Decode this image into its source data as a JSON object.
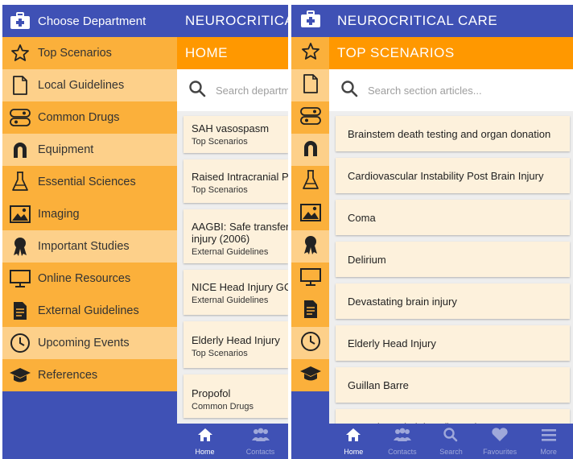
{
  "left": {
    "drawer": {
      "header_label": "Choose Department",
      "items": [
        {
          "label": "Top Scenarios",
          "icon": "star-icon"
        },
        {
          "label": "Local Guidelines",
          "icon": "document-icon"
        },
        {
          "label": "Common Drugs",
          "icon": "pill-icon"
        },
        {
          "label": "Equipment",
          "icon": "magnet-icon"
        },
        {
          "label": "Essential Sciences",
          "icon": "flask-icon"
        },
        {
          "label": "Imaging",
          "icon": "image-icon"
        },
        {
          "label": "Important Studies",
          "icon": "ribbon-icon"
        },
        {
          "label": "Online Resources",
          "icon": "monitor-icon"
        },
        {
          "label": "External Guidelines",
          "icon": "text-document-icon"
        },
        {
          "label": "Upcoming Events",
          "icon": "clock-icon"
        },
        {
          "label": "References",
          "icon": "graduation-cap-icon"
        }
      ]
    },
    "app_title": "NEUROCRITICAL CARE",
    "section_title": "HOME",
    "search_placeholder": "Search departments...",
    "cards": [
      {
        "title": "SAH vasospasm",
        "subtitle": "Top Scenarios"
      },
      {
        "title": "Raised Intracranial Pressure",
        "subtitle": "Top Scenarios"
      },
      {
        "title": "AAGBI: Safe transfer",
        "title2": "injury (2006)",
        "subtitle": "External Guidelines"
      },
      {
        "title": "NICE Head Injury GC",
        "subtitle": "External Guidelines"
      },
      {
        "title": "Elderly Head Injury",
        "subtitle": "Top Scenarios"
      },
      {
        "title": "Propofol",
        "subtitle": "Common Drugs"
      }
    ],
    "bottom_nav": [
      {
        "label": "Home",
        "icon": "home-icon"
      },
      {
        "label": "Contacts",
        "icon": "contacts-icon"
      }
    ]
  },
  "right": {
    "app_title": "NEUROCRITICAL CARE",
    "section_title": "TOP SCENARIOS",
    "search_placeholder": "Search section articles...",
    "articles": [
      "Brainstem death testing and organ donation",
      "Cardiovascular Instability Post Brain Injury",
      "Coma",
      "Delirium",
      "Devastating brain injury",
      "Elderly Head Injury",
      "Guillan Barre",
      "Hypoxic Brain injury (hypoxia"
    ],
    "bottom_nav": [
      {
        "label": "Home",
        "icon": "home-icon"
      },
      {
        "label": "Contacts",
        "icon": "contacts-icon"
      },
      {
        "label": "Search",
        "icon": "search-icon"
      },
      {
        "label": "Favourites",
        "icon": "heart-icon"
      },
      {
        "label": "More",
        "icon": "menu-icon"
      }
    ]
  },
  "colors": {
    "primary": "#3f51b5",
    "accent_orange": "#ff9800",
    "menu_dark": "#fbb03b",
    "menu_light": "#fdd08a",
    "card_bg": "#fdf1dc"
  }
}
